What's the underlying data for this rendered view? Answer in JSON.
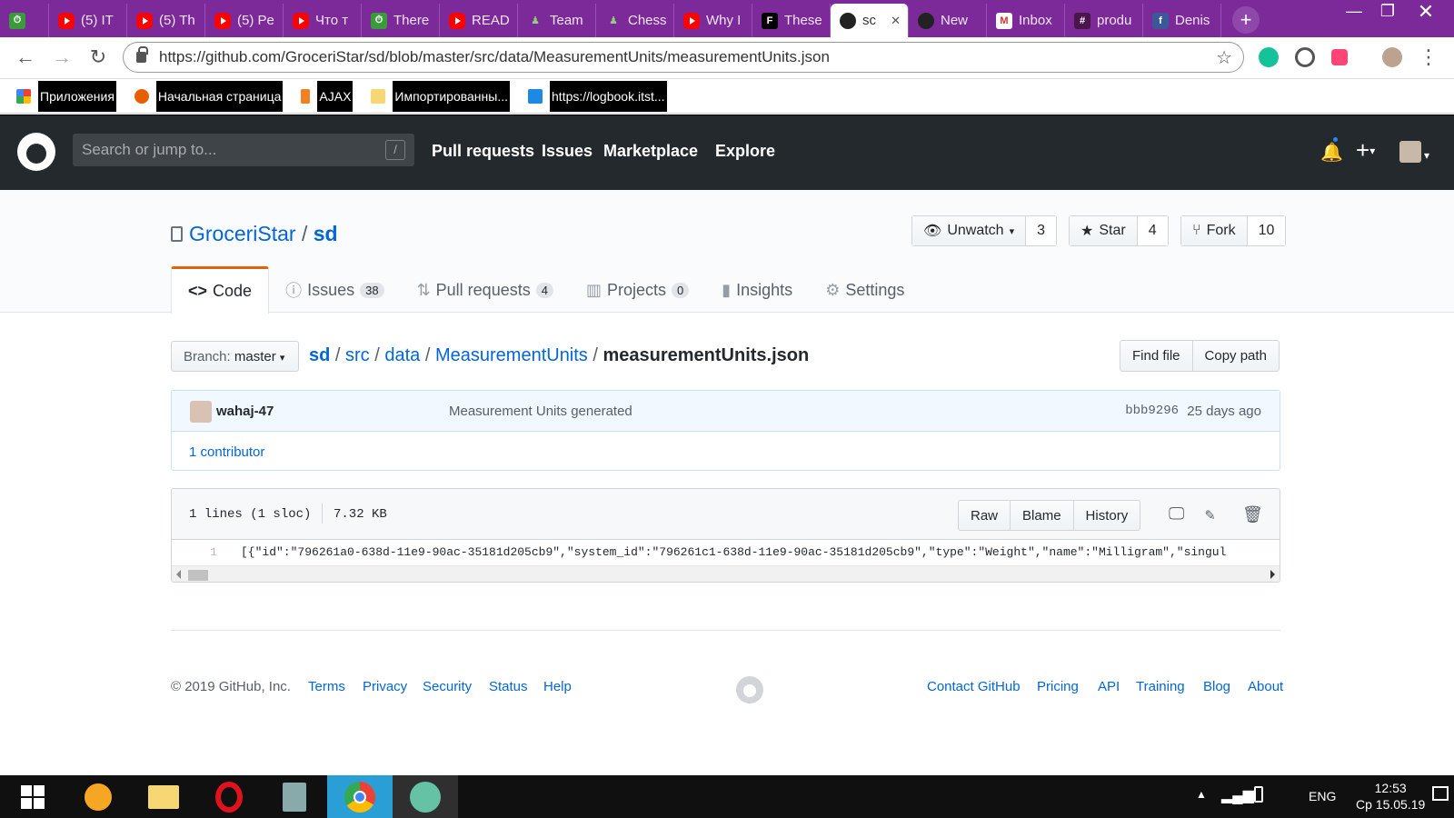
{
  "browser": {
    "tabs": [
      {
        "title": "",
        "icon": "timer"
      },
      {
        "title": "(5) IT",
        "icon": "youtube"
      },
      {
        "title": "(5) Th",
        "icon": "youtube"
      },
      {
        "title": "(5) Pe",
        "icon": "youtube"
      },
      {
        "title": "Что т",
        "icon": "youtube"
      },
      {
        "title": "There",
        "icon": "timer"
      },
      {
        "title": "READ",
        "icon": "youtube"
      },
      {
        "title": "Team",
        "icon": "chess-pawn"
      },
      {
        "title": "Chess",
        "icon": "chess-pawn"
      },
      {
        "title": "Why I",
        "icon": "youtube"
      },
      {
        "title": "These",
        "icon": "f-logo"
      },
      {
        "title": "sc",
        "icon": "github",
        "active": true
      },
      {
        "title": "New",
        "icon": "github"
      },
      {
        "title": "Inbox",
        "icon": "gmail"
      },
      {
        "title": "produ",
        "icon": "slack"
      },
      {
        "title": "Denis",
        "icon": "facebook"
      }
    ],
    "url": "https://github.com/GroceriStar/sd/blob/master/src/data/MeasurementUnits/measurementUnits.json",
    "bookmarks": [
      {
        "label": "Приложения",
        "icon": "apps"
      },
      {
        "label": "Начальная страница",
        "icon": "firefox"
      },
      {
        "label": "AJAX",
        "icon": "stackoverflow"
      },
      {
        "label": "Импортированны...",
        "icon": "folder"
      },
      {
        "label": "https://logbook.itst...",
        "icon": "book"
      }
    ]
  },
  "github_header": {
    "search_placeholder": "Search or jump to...",
    "search_key": "/",
    "nav": [
      "Pull requests",
      "Issues",
      "Marketplace",
      "Explore"
    ]
  },
  "repo": {
    "owner": "GroceriStar",
    "name": "sd",
    "separator": "/",
    "watch_label": "Unwatch",
    "watch_count": "3",
    "star_label": "Star",
    "star_count": "4",
    "fork_label": "Fork",
    "fork_count": "10",
    "tabs": [
      {
        "label": "Code",
        "count": ""
      },
      {
        "label": "Issues",
        "count": "38"
      },
      {
        "label": "Pull requests",
        "count": "4"
      },
      {
        "label": "Projects",
        "count": "0"
      },
      {
        "label": "Insights",
        "count": ""
      },
      {
        "label": "Settings",
        "count": ""
      }
    ]
  },
  "file_nav": {
    "branch_prefix": "Branch:",
    "branch": "master",
    "crumbs": [
      "sd",
      "src",
      "data",
      "MeasurementUnits"
    ],
    "file": "measurementUnits.json",
    "find_file": "Find file",
    "copy_path": "Copy path"
  },
  "commit": {
    "author": "wahaj-47",
    "message": "Measurement Units generated",
    "sha": "bbb9296",
    "time": "25 days ago",
    "contributors": "1 contributor"
  },
  "file": {
    "lines_info": "1 lines (1 sloc)",
    "size": "7.32 KB",
    "buttons": [
      "Raw",
      "Blame",
      "History"
    ],
    "line_number": "1",
    "line_text": "[{\"id\":\"796261a0-638d-11e9-90ac-35181d205cb9\",\"system_id\":\"796261c1-638d-11e9-90ac-35181d205cb9\",\"type\":\"Weight\",\"name\":\"Milligram\",\"singul"
  },
  "footer": {
    "copyright": "© 2019 GitHub, Inc.",
    "left_links": [
      "Terms",
      "Privacy",
      "Security",
      "Status",
      "Help"
    ],
    "right_links": [
      "Contact GitHub",
      "Pricing",
      "API",
      "Training",
      "Blog",
      "About"
    ]
  },
  "taskbar": {
    "lang": "ENG",
    "time": "12:53",
    "date": "Ср 15.05.19"
  }
}
